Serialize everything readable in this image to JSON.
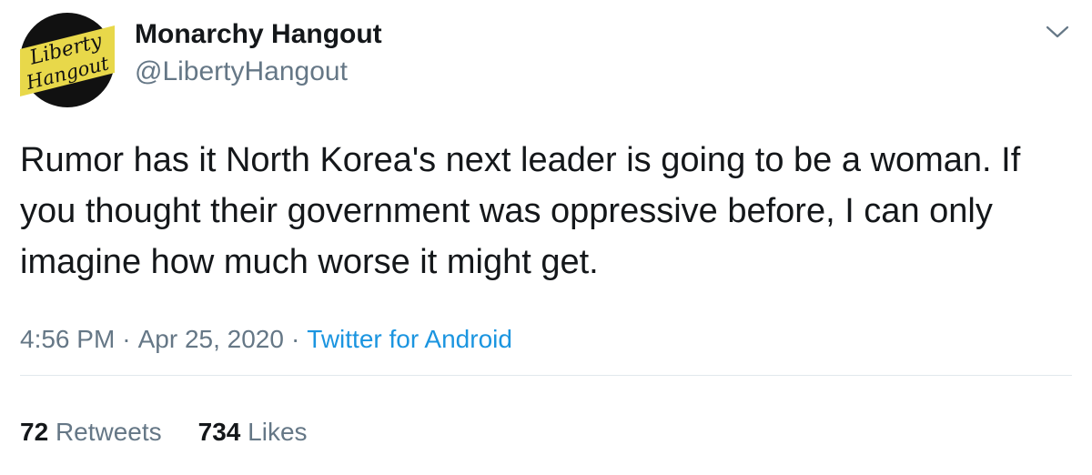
{
  "author": {
    "display_name": "Monarchy Hangout",
    "handle": "@LibertyHangout",
    "avatar_text_line1": "Liberty",
    "avatar_text_line2": "Hangout"
  },
  "tweet": {
    "text": "Rumor has it North Korea's next leader is going to be a woman. If you thought their government was oppressive before, I can only imagine how much worse it might get."
  },
  "meta": {
    "time": "4:56 PM",
    "separator": "·",
    "date": "Apr 25, 2020",
    "source": "Twitter for Android"
  },
  "stats": {
    "retweets_count": "72",
    "retweets_label": "Retweets",
    "likes_count": "734",
    "likes_label": "Likes"
  },
  "colors": {
    "text": "#14171a",
    "secondary": "#657786",
    "link": "#1b95e0",
    "divider": "#e1e8ed",
    "avatar_bg": "#e8d84a"
  },
  "icons": {
    "menu": "chevron-down-icon"
  }
}
